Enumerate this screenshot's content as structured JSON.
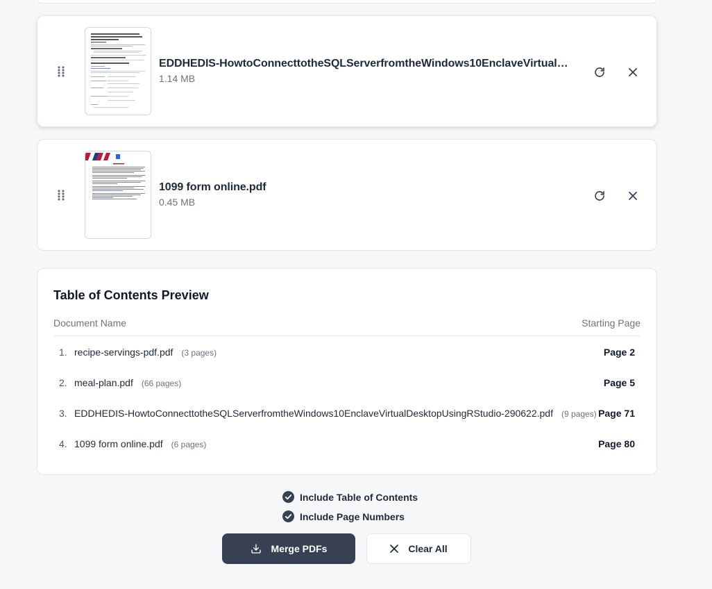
{
  "files": [
    {
      "name": "EDDHEDIS-HowtoConnecttotheSQLServerfromtheWindows10EnclaveVirtualDesktopUsingRStudio-290622.pdf",
      "size": "1.14 MB",
      "icons": {
        "drag": "drag-handle-icon",
        "rotate": "rotate-icon",
        "remove": "close-icon"
      }
    },
    {
      "name": "1099 form online.pdf",
      "size": "0.45 MB",
      "icons": {
        "drag": "drag-handle-icon",
        "rotate": "rotate-icon",
        "remove": "close-icon"
      }
    }
  ],
  "toc": {
    "title": "Table of Contents Preview",
    "col_document": "Document Name",
    "col_start": "Starting Page",
    "rows": [
      {
        "num": "1.",
        "name": "recipe-servings-pdf.pdf",
        "pages": "(3 pages)",
        "start": "Page 2"
      },
      {
        "num": "2.",
        "name": "meal-plan.pdf",
        "pages": "(66 pages)",
        "start": "Page 5"
      },
      {
        "num": "3.",
        "name": "EDDHEDIS-HowtoConnecttotheSQLServerfromtheWindows10EnclaveVirtualDesktopUsingRStudio-290622.pdf",
        "pages": "(9 pages)",
        "start": "Page 71"
      },
      {
        "num": "4.",
        "name": "1099 form online.pdf",
        "pages": "(6 pages)",
        "start": "Page 80"
      }
    ]
  },
  "options": {
    "include_toc": {
      "label": "Include Table of Contents",
      "checked": true
    },
    "include_page_numbers": {
      "label": "Include Page Numbers",
      "checked": true
    }
  },
  "actions": {
    "merge_label": "Merge PDFs",
    "clear_label": "Clear All"
  },
  "colors": {
    "primary_button": "#374151",
    "card_border": "#e2e5ea",
    "muted_text": "#6b7280"
  }
}
